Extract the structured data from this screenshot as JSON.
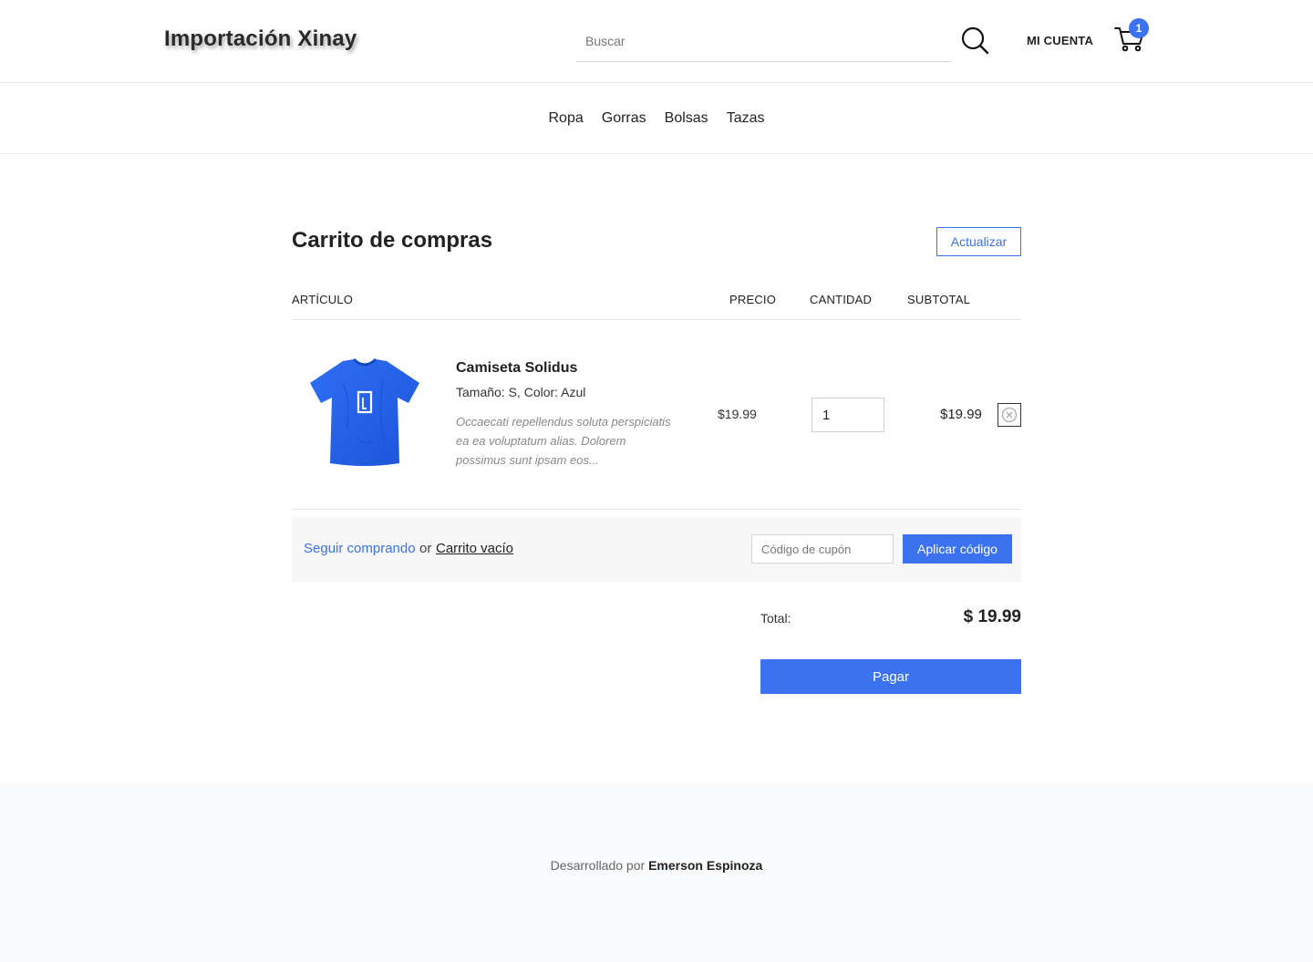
{
  "header": {
    "logo": "Importación Xinay",
    "search_placeholder": "Buscar",
    "account_label": "MI CUENTA",
    "cart_count": "1",
    "accent_color": "#3b72f0"
  },
  "nav": {
    "items": [
      {
        "label": "Ropa"
      },
      {
        "label": "Gorras"
      },
      {
        "label": "Bolsas"
      },
      {
        "label": "Tazas"
      }
    ]
  },
  "cart": {
    "title": "Carrito de compras",
    "update_label": "Actualizar",
    "columns": {
      "item": "ARTÍCULO",
      "price": "PRECIO",
      "quantity": "CANTIDAD",
      "subtotal": "SUBTOTAL"
    },
    "items": [
      {
        "name": "Camiseta Solidus",
        "variant": "Tamaño: S, Color: Azul",
        "description": "Occaecati repellendus soluta perspiciatis ea ea voluptatum alias. Dolorem possimus sunt ipsam eos...",
        "price": "$19.99",
        "quantity": "1",
        "subtotal": "$19.99",
        "image_icon": "tshirt-blue"
      }
    ],
    "continue_label": "Seguir comprando",
    "or_label": "or",
    "empty_label": "Carrito vacío",
    "coupon_placeholder": "Código de cupón",
    "apply_label": "Aplicar código",
    "total_label": "Total:",
    "total_value": "$ 19.99",
    "pay_label": "Pagar"
  },
  "footer": {
    "prefix": "Desarrollado por",
    "author": "Emerson Espinoza"
  }
}
